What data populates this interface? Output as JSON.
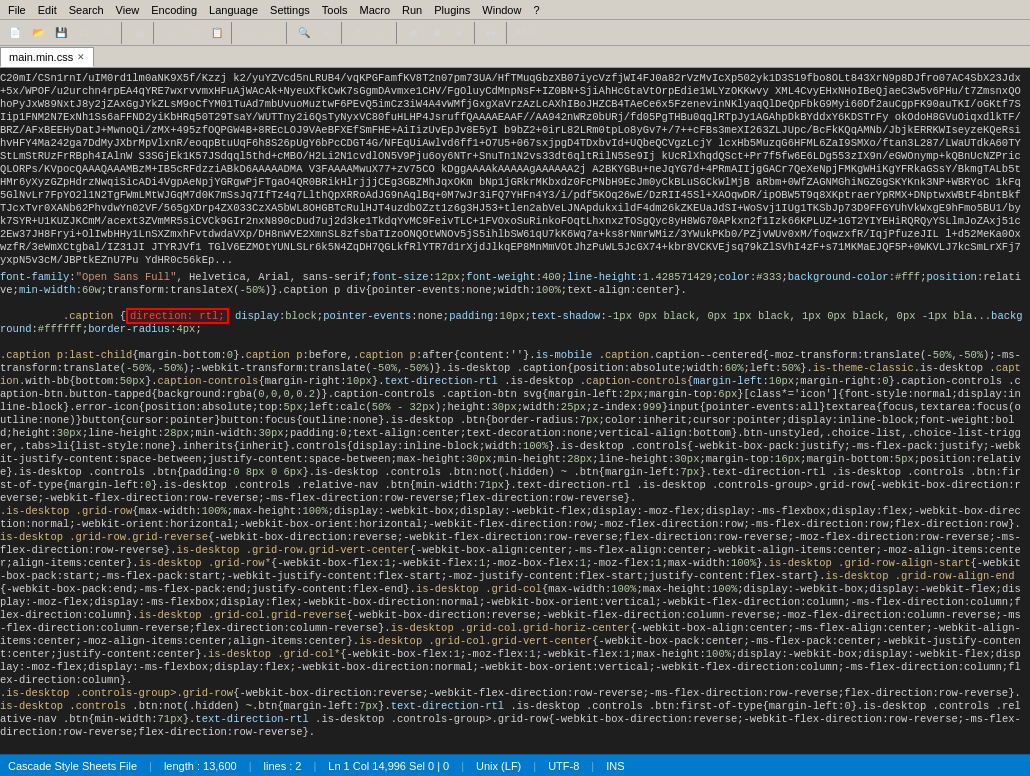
{
  "menubar": {
    "items": [
      "File",
      "Edit",
      "Search",
      "View",
      "Encoding",
      "Language",
      "Settings",
      "Tools",
      "Macro",
      "Run",
      "Plugins",
      "Window",
      "?"
    ]
  },
  "tab": {
    "label": "main.min.css",
    "active": true
  },
  "statusbar": {
    "file_type": "Cascade Style Sheets File",
    "length": "length : 13,600",
    "lines": "lines : 2",
    "position": "Ln 1  Col 14,996  Sel 0 | 0",
    "encoding": "Unix (LF)",
    "charset": "UTF-8",
    "mode": "INS"
  },
  "toolbar_icons": [
    "new-icon",
    "open-icon",
    "save-icon",
    "sep1",
    "cut-icon",
    "copy-icon",
    "paste-icon",
    "sep2",
    "undo-icon",
    "redo-icon",
    "sep3",
    "find-icon",
    "replace-icon",
    "sep4",
    "zoom-in-icon",
    "zoom-out-icon",
    "sep5",
    "run-icon",
    "stop-icon",
    "sep6",
    "settings-icon"
  ]
}
